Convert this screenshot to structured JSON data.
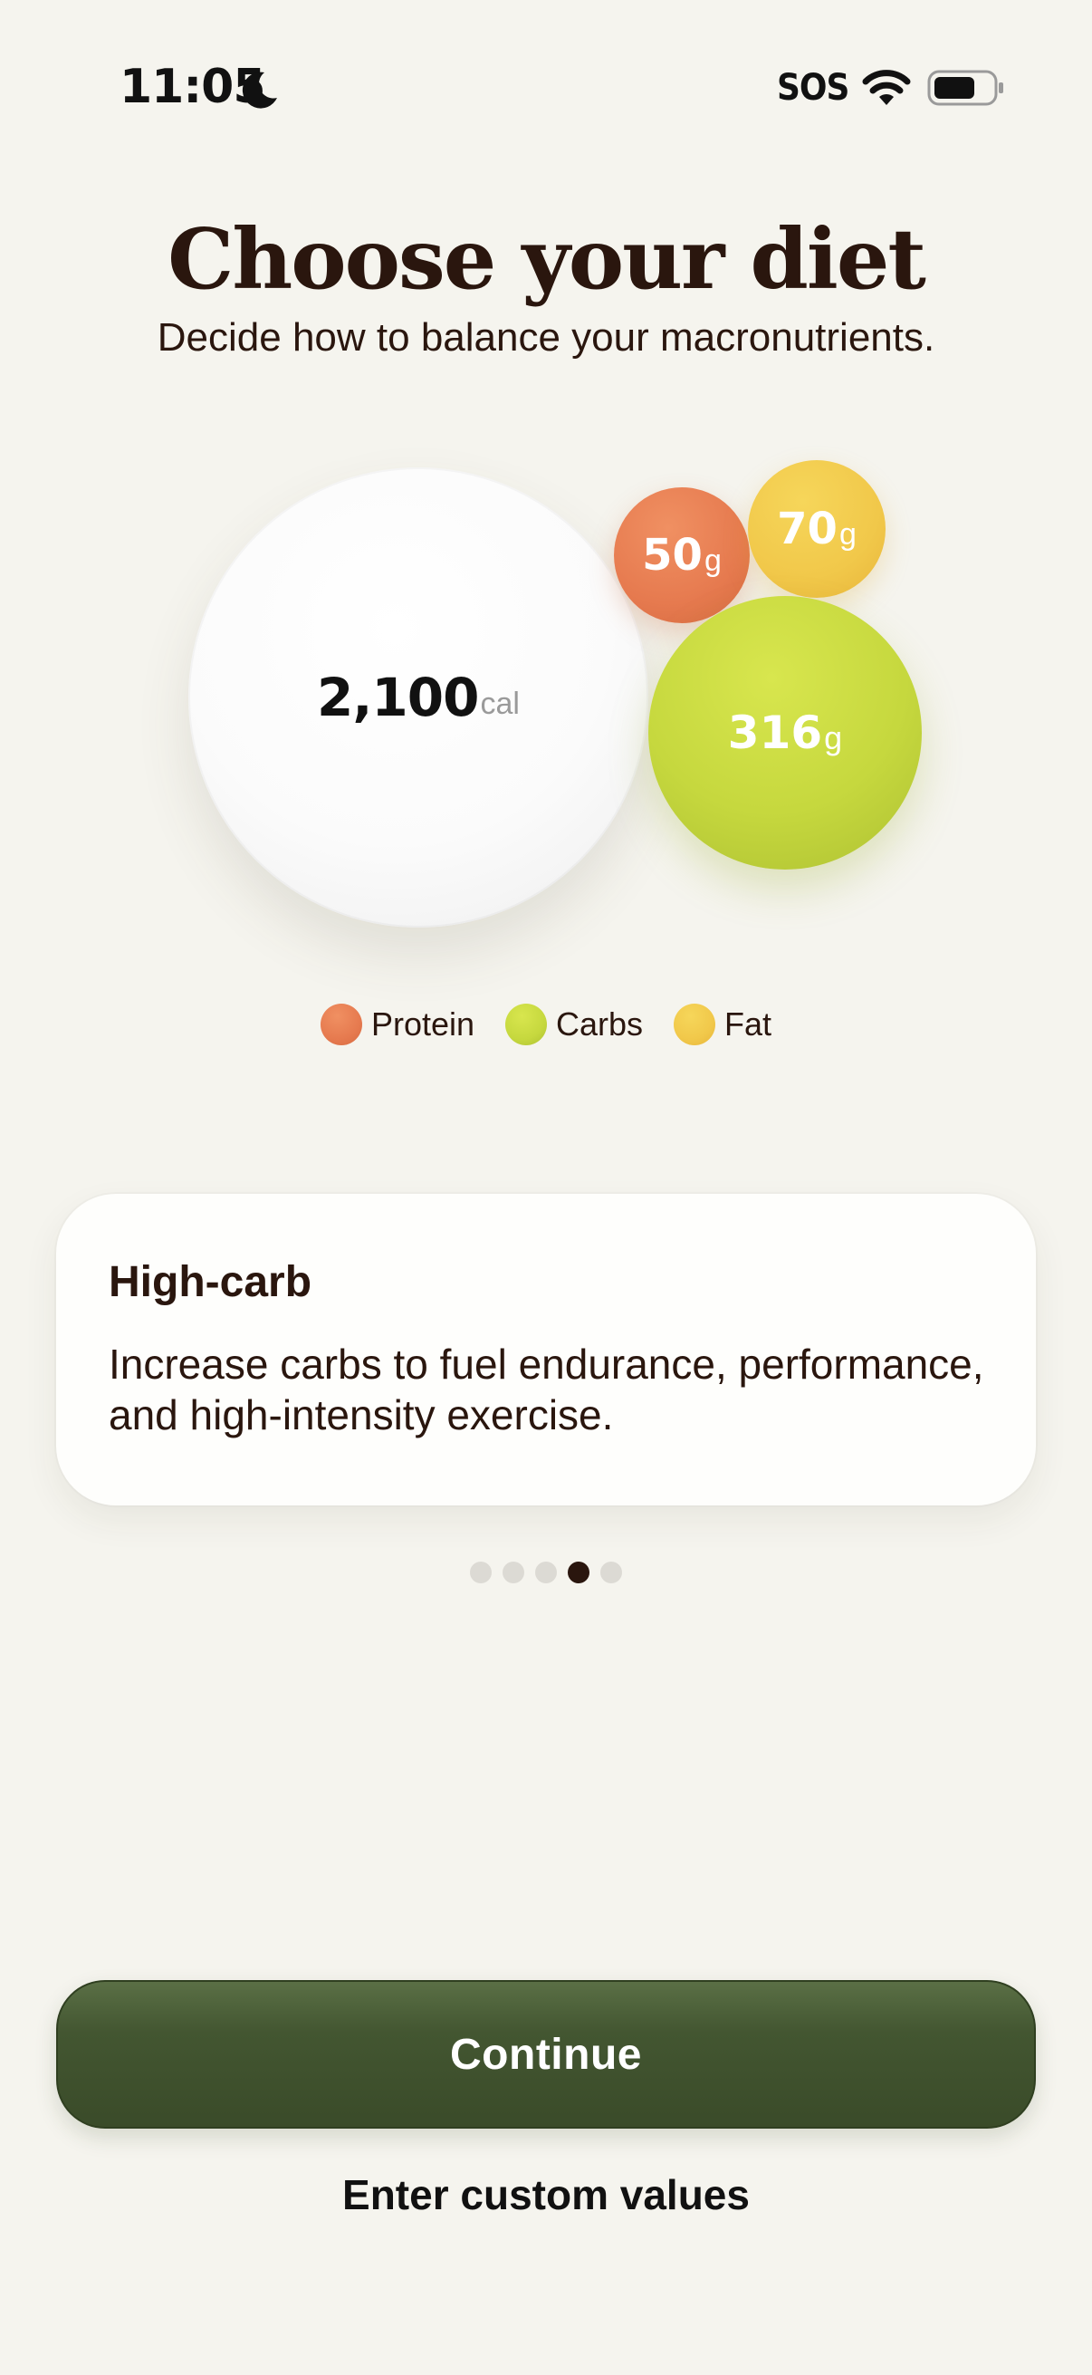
{
  "status_bar": {
    "time": "11:05",
    "sos": "SOS"
  },
  "header": {
    "title": "Choose your diet",
    "subtitle": "Decide how to balance your macronutrients."
  },
  "macros": {
    "calories": {
      "value": "2,100",
      "unit": "cal"
    },
    "protein": {
      "value": "50",
      "unit": "g",
      "color": "#e67a4f"
    },
    "fat": {
      "value": "70",
      "unit": "g",
      "color": "#f1c84a"
    },
    "carbs": {
      "value": "316",
      "unit": "g",
      "color": "#c6d83e"
    }
  },
  "legend": {
    "protein": "Protein",
    "carbs": "Carbs",
    "fat": "Fat"
  },
  "diet_card": {
    "title": "High-carb",
    "description": "Increase carbs to fuel endurance, performance, and high-intensity exercise."
  },
  "pager": {
    "total": 5,
    "active_index": 3
  },
  "actions": {
    "continue_label": "Continue",
    "custom_label": "Enter custom values"
  }
}
